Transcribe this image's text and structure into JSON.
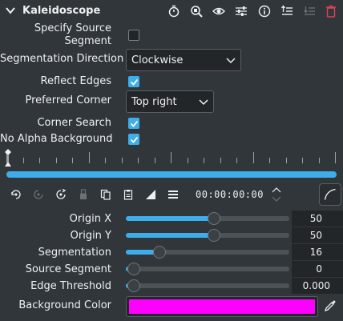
{
  "header": {
    "title": "Kaleidoscope",
    "icons": [
      "stopwatch-icon",
      "search-compare-icon",
      "eye-icon",
      "sliders-icon",
      "info-icon",
      "save-preset-icon",
      "unknown-disabled-icon",
      "trash-icon"
    ]
  },
  "params": {
    "specify_source_segment": {
      "label_line1": "Specify Source",
      "label_line2": "Segment",
      "checked": false
    },
    "segmentation_direction": {
      "label": "Segmentation Direction",
      "value": "Clockwise"
    },
    "reflect_edges": {
      "label": "Reflect Edges",
      "checked": true
    },
    "preferred_corner": {
      "label": "Preferred Corner",
      "value": "Top right"
    },
    "corner_search": {
      "label": "Corner Search",
      "checked": true
    },
    "no_alpha_background": {
      "label": "No Alpha Background",
      "checked": true
    }
  },
  "keyframes": {
    "timecode": "00:00:00:00",
    "toolbar_icons": [
      "add-keyframe-icon",
      "remove-keyframe-icon",
      "next-keyframe-icon",
      "paste-disabled-icon",
      "copy-icon",
      "clipboard-icon",
      "curve-type-icon",
      "menu-icon"
    ],
    "curve_button_icon": "curve-icon"
  },
  "sliders": [
    {
      "label": "Origin X",
      "value": "50",
      "fraction": 0.5
    },
    {
      "label": "Origin Y",
      "value": "50",
      "fraction": 0.5
    },
    {
      "label": "Segmentation",
      "value": "16",
      "fraction": 0.16
    },
    {
      "label": "Source Segment",
      "value": "0",
      "fraction": 0.0
    },
    {
      "label": "Edge Threshold",
      "value": "0.000",
      "fraction": 0.0
    }
  ],
  "background_color": {
    "label": "Background Color",
    "color": "#ff00ff"
  },
  "colors": {
    "accent": "#3daee9",
    "background": "#31363b",
    "field": "#232629",
    "delete": "#da4453"
  }
}
